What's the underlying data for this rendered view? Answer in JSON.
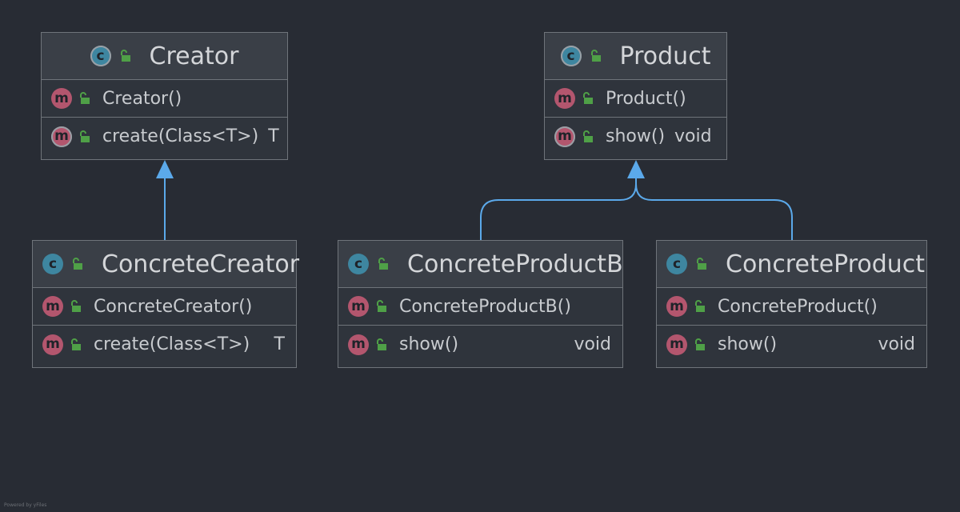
{
  "classes": {
    "creator": {
      "name": "Creator",
      "members": [
        {
          "name": "Creator()",
          "type": ""
        },
        {
          "name": "create(Class<T>)",
          "type": "T"
        }
      ]
    },
    "product": {
      "name": "Product",
      "members": [
        {
          "name": "Product()",
          "type": ""
        },
        {
          "name": "show()",
          "type": "void"
        }
      ]
    },
    "concrete_creator": {
      "name": "ConcreteCreator",
      "members": [
        {
          "name": "ConcreteCreator()",
          "type": ""
        },
        {
          "name": "create(Class<T>)",
          "type": "T"
        }
      ]
    },
    "concrete_product_b": {
      "name": "ConcreteProductB",
      "members": [
        {
          "name": "ConcreteProductB()",
          "type": ""
        },
        {
          "name": "show()",
          "type": "void"
        }
      ]
    },
    "concrete_product": {
      "name": "ConcreteProduct",
      "members": [
        {
          "name": "ConcreteProduct()",
          "type": ""
        },
        {
          "name": "show()",
          "type": "void"
        }
      ]
    }
  },
  "icons": {
    "class": "c",
    "method": "m",
    "visibility": "unlocked-lock-icon"
  },
  "colors": {
    "background": "#282c34",
    "class_icon": "#3e86a0",
    "method_icon": "#b3566e",
    "lock": "#4fa047",
    "arrow": "#5ba9ea"
  },
  "watermark": "Powered by yFiles"
}
